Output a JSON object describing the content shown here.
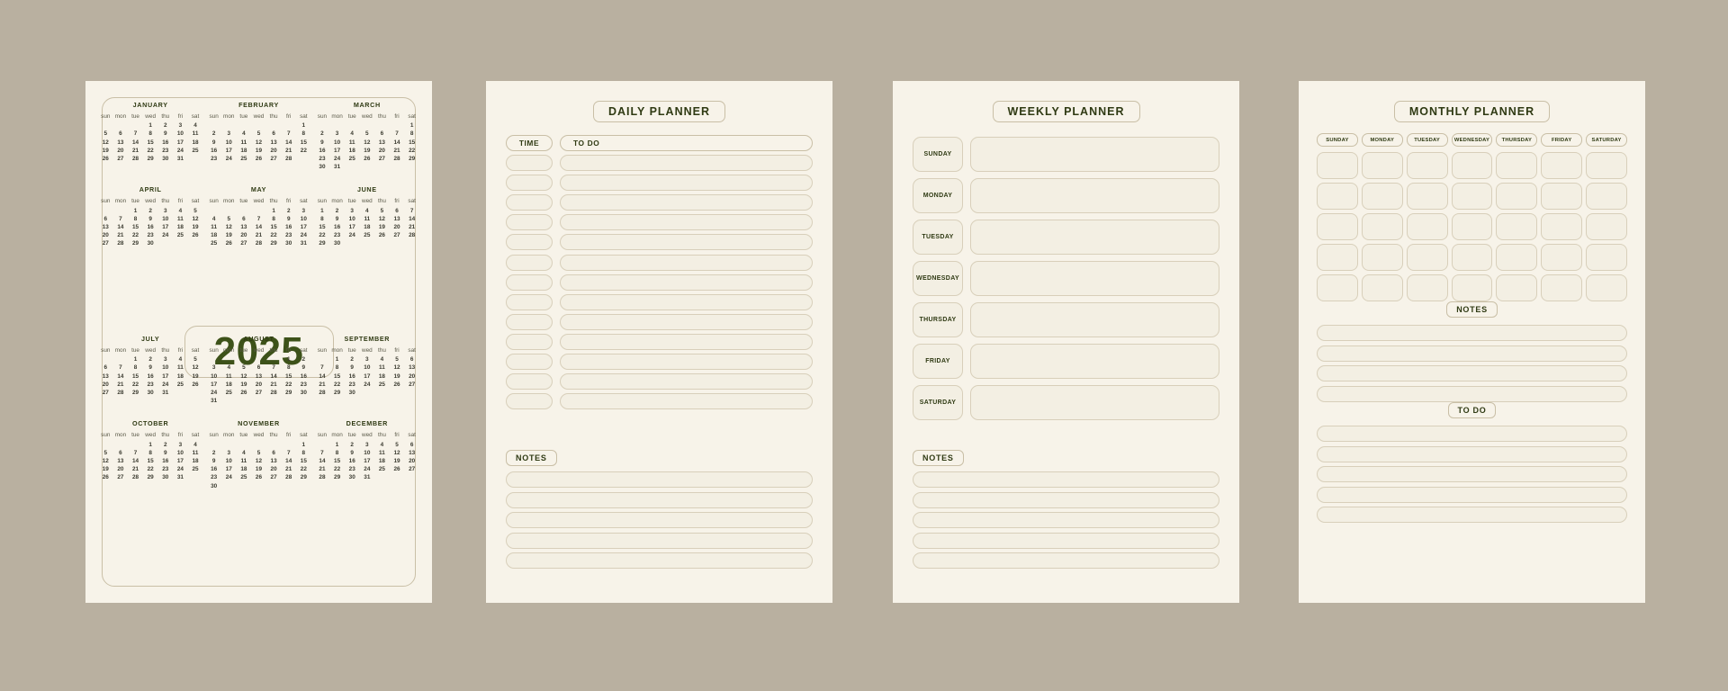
{
  "background_color": "#b9b0a0",
  "paper_color": "#f7f3e9",
  "ink_color": "#3f4a1d",
  "accent_color": "#3d5219",
  "border_color": "#c9bfa6",
  "year_page": {
    "year_label": "2025",
    "weekday_abbr": [
      "sun",
      "mon",
      "tue",
      "wed",
      "thu",
      "fri",
      "sat"
    ],
    "months": [
      {
        "name": "JANUARY",
        "lead": 3,
        "days": 31
      },
      {
        "name": "FEBRUARY",
        "lead": 6,
        "days": 28
      },
      {
        "name": "MARCH",
        "lead": 6,
        "days": 31
      },
      {
        "name": "APRIL",
        "lead": 2,
        "days": 30
      },
      {
        "name": "MAY",
        "lead": 4,
        "days": 31
      },
      {
        "name": "JUNE",
        "lead": 0,
        "days": 30
      },
      {
        "name": "JULY",
        "lead": 2,
        "days": 31
      },
      {
        "name": "AUGUST",
        "lead": 5,
        "days": 31
      },
      {
        "name": "SEPTEMBER",
        "lead": 1,
        "days": 30
      },
      {
        "name": "OCTOBER",
        "lead": 3,
        "days": 31
      },
      {
        "name": "NOVEMBER",
        "lead": 6,
        "days": 30
      },
      {
        "name": "DECEMBER",
        "lead": 1,
        "days": 31
      }
    ]
  },
  "daily_page": {
    "title": "DAILY PLANNER",
    "col_time_label": "TIME",
    "col_todo_label": "TO DO",
    "row_count": 13,
    "notes_label": "NOTES",
    "notes_line_count": 5
  },
  "weekly_page": {
    "title": "WEEKLY PLANNER",
    "days": [
      "SUNDAY",
      "MONDAY",
      "TUESDAY",
      "WEDNESDAY",
      "THURSDAY",
      "FRIDAY",
      "SATURDAY"
    ],
    "notes_label": "NOTES",
    "notes_line_count": 5
  },
  "monthly_page": {
    "title": "MONTHLY PLANNER",
    "weekdays": [
      "SUNDAY",
      "MONDAY",
      "TUESDAY",
      "WEDNESDAY",
      "THURSDAY",
      "FRIDAY",
      "SATURDAY"
    ],
    "grid_rows": 5,
    "grid_cols": 7,
    "notes_label": "NOTES",
    "notes_line_count": 4,
    "todo_label": "TO DO",
    "todo_line_count": 5
  }
}
